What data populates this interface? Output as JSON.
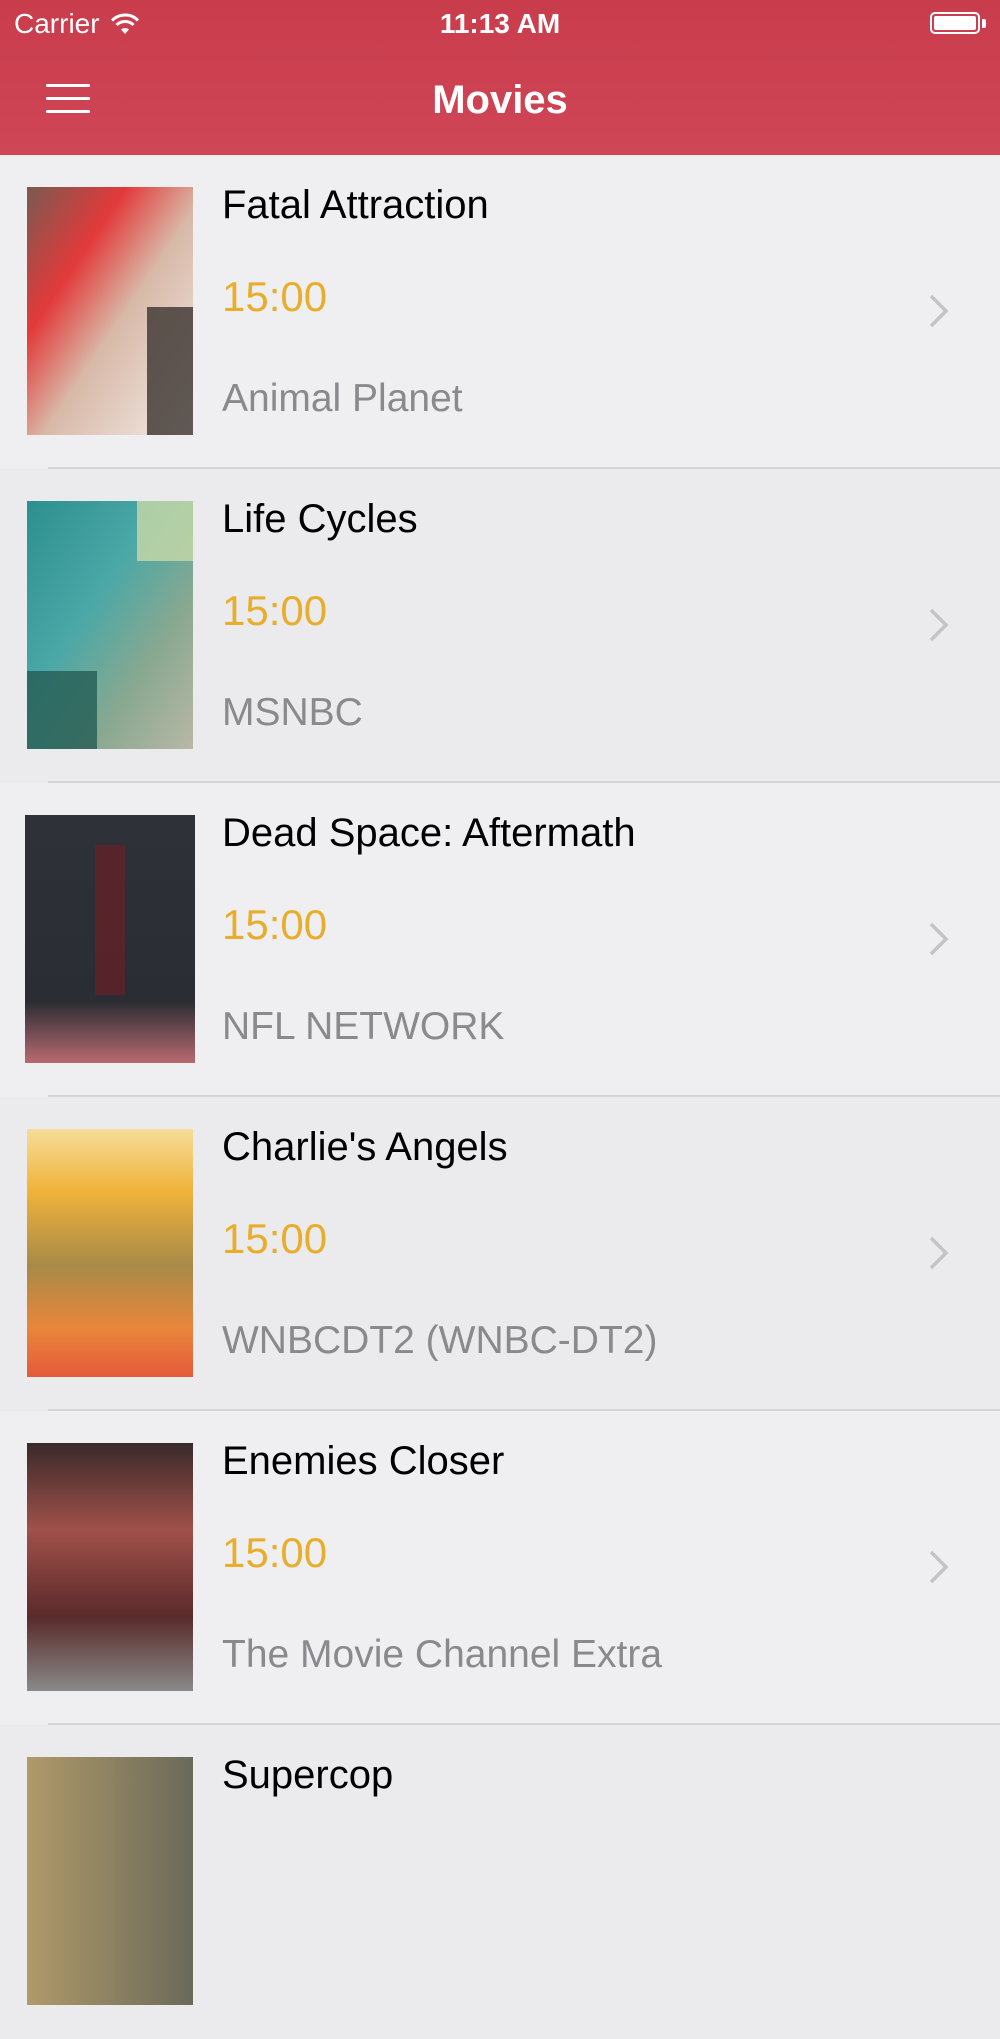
{
  "status_bar": {
    "carrier": "Carrier",
    "time": "11:13 AM",
    "wifi_icon": "wifi-icon",
    "battery_icon": "battery-icon"
  },
  "nav": {
    "title": "Movies",
    "menu_icon": "hamburger-menu-icon",
    "background_color": "#cc4252"
  },
  "accent_time_color": "#e8ad2a",
  "movies": [
    {
      "title": "Fatal Attraction",
      "time": "15:00",
      "channel": "Animal Planet"
    },
    {
      "title": "Life Cycles",
      "time": "15:00",
      "channel": "MSNBC"
    },
    {
      "title": "Dead Space: Aftermath",
      "time": "15:00",
      "channel": "NFL NETWORK"
    },
    {
      "title": "Charlie's Angels",
      "time": "15:00",
      "channel": "WNBCDT2 (WNBC-DT2)"
    },
    {
      "title": "Enemies Closer",
      "time": "15:00",
      "channel": "The Movie Channel Extra"
    },
    {
      "title": "Supercop",
      "time": "",
      "channel": ""
    }
  ]
}
